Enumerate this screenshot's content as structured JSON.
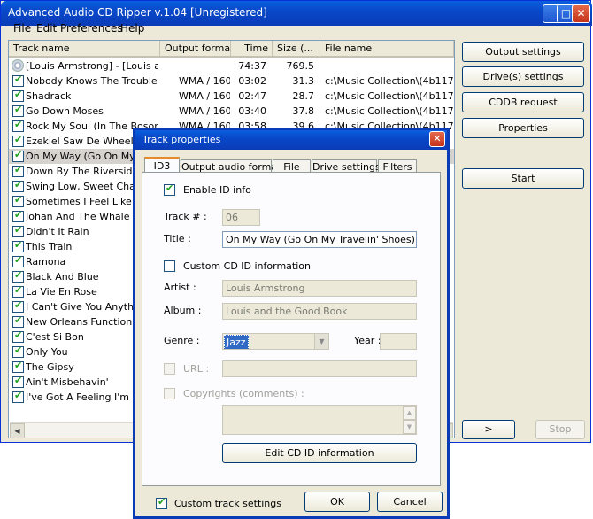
{
  "window": {
    "title": "Advanced Audio CD Ripper v.1.04 [Unregistered]",
    "controls": {
      "minimize": "_",
      "maximize": "□",
      "close": "✕"
    }
  },
  "menu": [
    "File",
    "Edit",
    "Preferences",
    "Help"
  ],
  "table": {
    "columns": [
      "Track name",
      "Output format",
      "Time",
      "Size (...",
      "File name"
    ],
    "header_row": {
      "name": "[Louis Armstrong] - [Louis a...",
      "format": "",
      "time": "74:37",
      "size": "769.5",
      "file": ""
    },
    "rows": [
      {
        "name": "Nobody Knows The Trouble ...",
        "format": "WMA / 160",
        "time": "03:02",
        "size": "31.3",
        "file": "c:\\Music Collection\\(4b117d16)"
      },
      {
        "name": "Shadrack",
        "format": "WMA / 160",
        "time": "02:47",
        "size": "28.7",
        "file": "c:\\Music Collection\\(4b117d16)"
      },
      {
        "name": "Go Down Moses",
        "format": "WMA / 160",
        "time": "03:40",
        "size": "37.8",
        "file": "c:\\Music Collection\\(4b117d16)"
      },
      {
        "name": "Rock My Soul (In The Bosom...",
        "format": "WMA / 160",
        "time": "03:58",
        "size": "39.6",
        "file": "c:\\Music Collection\\(4b117d16)"
      },
      {
        "name": "Ezekiel Saw De Wheel",
        "format": "",
        "time": "",
        "size": "",
        "file": ""
      },
      {
        "name": "On My Way (Go On My Tr",
        "format": "",
        "time": "",
        "size": "",
        "file": ""
      },
      {
        "name": "Down By The Riverside",
        "format": "",
        "time": "",
        "size": "",
        "file": ""
      },
      {
        "name": "Swing Low, Sweet Chario",
        "format": "",
        "time": "",
        "size": "",
        "file": ""
      },
      {
        "name": "Sometimes I Feel Like A M",
        "format": "",
        "time": "",
        "size": "",
        "file": ""
      },
      {
        "name": "Johan And The Whale",
        "format": "",
        "time": "",
        "size": "",
        "file": ""
      },
      {
        "name": "Didn't It Rain",
        "format": "",
        "time": "",
        "size": "",
        "file": ""
      },
      {
        "name": "This Train",
        "format": "",
        "time": "",
        "size": "",
        "file": ""
      },
      {
        "name": "Ramona",
        "format": "",
        "time": "",
        "size": "",
        "file": ""
      },
      {
        "name": "Black And Blue",
        "format": "",
        "time": "",
        "size": "",
        "file": ""
      },
      {
        "name": "La Vie En Rose",
        "format": "",
        "time": "",
        "size": "",
        "file": ""
      },
      {
        "name": "I Can't Give You Anything",
        "format": "",
        "time": "",
        "size": "",
        "file": ""
      },
      {
        "name": "New Orleans Function",
        "format": "",
        "time": "",
        "size": "",
        "file": ""
      },
      {
        "name": "C'est Si Bon",
        "format": "",
        "time": "",
        "size": "",
        "file": ""
      },
      {
        "name": "Only You",
        "format": "",
        "time": "",
        "size": "",
        "file": ""
      },
      {
        "name": "The Gipsy",
        "format": "",
        "time": "",
        "size": "",
        "file": ""
      },
      {
        "name": "Ain't Misbehavin'",
        "format": "",
        "time": "",
        "size": "",
        "file": ""
      },
      {
        "name": "I've Got A Feeling I'm Fall",
        "format": "",
        "time": "",
        "size": "",
        "file": ""
      }
    ],
    "selected_index": 5
  },
  "side_buttons": {
    "output_settings": "Output settings",
    "drive_settings": "Drive(s) settings",
    "cddb_request": "CDDB request",
    "properties": "Properties",
    "start": "Start",
    "next": ">",
    "stop": "Stop"
  },
  "dialog": {
    "title": "Track properties",
    "tabs": [
      "ID3",
      "Output audio format",
      "File",
      "Drive settings",
      "Filters"
    ],
    "active_tab": 0,
    "enable_id_label": "Enable ID info",
    "track_label": "Track # :",
    "track_value": "06",
    "title_label": "Title :",
    "title_value": "On My Way (Go On My Travelin' Shoes)",
    "custom_cd_label": "Custom CD ID information",
    "artist_label": "Artist :",
    "artist_value": "Louis Armstrong",
    "album_label": "Album :",
    "album_value": "Louis and the Good Book",
    "genre_label": "Genre :",
    "genre_value": "Jazz",
    "year_label": "Year :",
    "year_value": "",
    "url_label": "URL :",
    "copyrights_label": "Copyrights (comments) :",
    "edit_cd_button": "Edit CD ID information",
    "custom_track_label": "Custom track settings",
    "ok": "OK",
    "cancel": "Cancel"
  },
  "colors": {
    "accent": "#0a3cb8",
    "check": "#21a121",
    "selection": "#d6d3ce"
  }
}
